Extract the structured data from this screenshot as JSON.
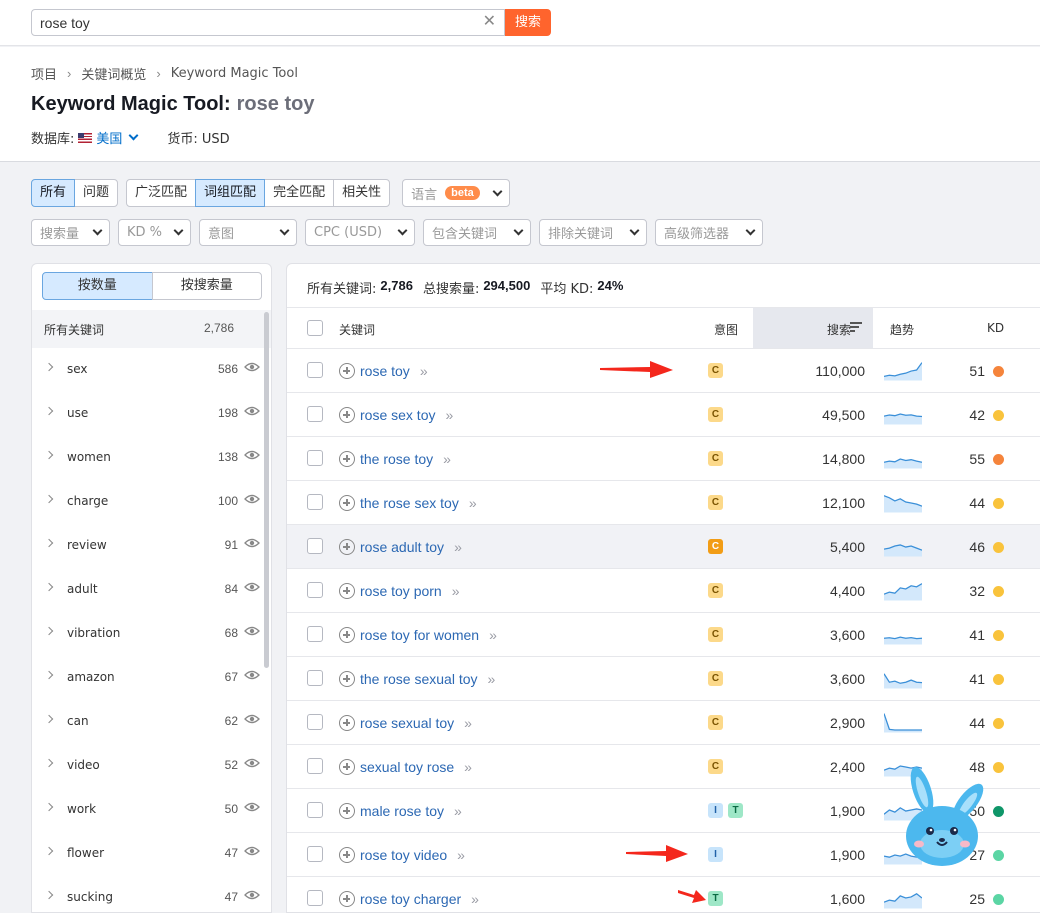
{
  "search": {
    "value": "rose toy",
    "button_label": "搜索"
  },
  "breadcrumb": [
    "项目",
    "关键词概览",
    "Keyword Magic Tool"
  ],
  "title": {
    "prefix": "Keyword Magic Tool:",
    "keyword": "rose toy"
  },
  "database": {
    "label": "数据库:",
    "country": "美国",
    "currency_label": "货币: USD"
  },
  "filters": {
    "match_group_a": [
      "所有",
      "问题"
    ],
    "match_group_b": [
      "广泛匹配",
      "词组匹配",
      "完全匹配",
      "相关性"
    ],
    "language": "语言",
    "beta": "beta",
    "dropdowns": [
      "搜索量",
      "KD %",
      "意图",
      "CPC (USD)",
      "包含关键词",
      "排除关键词",
      "高级筛选器"
    ]
  },
  "left_panel": {
    "toggle": [
      "按数量",
      "按搜索量"
    ],
    "all_label": "所有关键词",
    "all_count": "2,786",
    "groups": [
      {
        "name": "sex",
        "count": "586"
      },
      {
        "name": "use",
        "count": "198"
      },
      {
        "name": "women",
        "count": "138"
      },
      {
        "name": "charge",
        "count": "100"
      },
      {
        "name": "review",
        "count": "91"
      },
      {
        "name": "adult",
        "count": "84"
      },
      {
        "name": "vibration",
        "count": "68"
      },
      {
        "name": "amazon",
        "count": "67"
      },
      {
        "name": "can",
        "count": "62"
      },
      {
        "name": "video",
        "count": "52"
      },
      {
        "name": "work",
        "count": "50"
      },
      {
        "name": "flower",
        "count": "47"
      },
      {
        "name": "sucking",
        "count": "47"
      }
    ]
  },
  "summary": {
    "all_label": "所有关键词:",
    "all_value": "2,786",
    "volume_label": "总搜索量:",
    "volume_value": "294,500",
    "kd_label": "平均 KD:",
    "kd_value": "24%"
  },
  "table": {
    "headers": {
      "keyword": "关键词",
      "intent": "意图",
      "volume": "搜索",
      "trend": "趋势",
      "kd": "KD"
    },
    "rows": [
      {
        "keyword": "rose toy",
        "intent": [
          "C"
        ],
        "volume": "110,000",
        "kd": "51",
        "kd_color": "#f5843b",
        "trend": [
          0.2,
          0.25,
          0.22,
          0.3,
          0.35,
          0.45,
          0.5,
          0.85
        ]
      },
      {
        "keyword": "rose sex toy",
        "intent": [
          "C"
        ],
        "volume": "49,500",
        "kd": "42",
        "kd_color": "#f9c33c",
        "trend": [
          0.4,
          0.45,
          0.42,
          0.5,
          0.44,
          0.46,
          0.4,
          0.38
        ]
      },
      {
        "keyword": "the rose toy",
        "intent": [
          "C"
        ],
        "volume": "14,800",
        "kd": "55",
        "kd_color": "#f5843b",
        "trend": [
          0.3,
          0.35,
          0.32,
          0.45,
          0.38,
          0.42,
          0.35,
          0.3
        ]
      },
      {
        "keyword": "the rose sex toy",
        "intent": [
          "C"
        ],
        "volume": "12,100",
        "kd": "44",
        "kd_color": "#f9c33c",
        "trend": [
          0.8,
          0.7,
          0.55,
          0.65,
          0.5,
          0.45,
          0.4,
          0.3
        ]
      },
      {
        "keyword": "rose adult toy",
        "intent": [
          "Cstrong"
        ],
        "volume": "5,400",
        "kd": "46",
        "kd_color": "#f9c33c",
        "trend": [
          0.35,
          0.4,
          0.5,
          0.55,
          0.45,
          0.5,
          0.4,
          0.3
        ]
      },
      {
        "keyword": "rose toy porn",
        "intent": [
          "C"
        ],
        "volume": "4,400",
        "kd": "32",
        "kd_color": "#f9c33c",
        "trend": [
          0.3,
          0.4,
          0.35,
          0.6,
          0.55,
          0.7,
          0.65,
          0.8
        ]
      },
      {
        "keyword": "rose toy for women",
        "intent": [
          "C"
        ],
        "volume": "3,600",
        "kd": "41",
        "kd_color": "#f9c33c",
        "trend": [
          0.3,
          0.32,
          0.28,
          0.35,
          0.3,
          0.33,
          0.28,
          0.3
        ]
      },
      {
        "keyword": "the rose sexual toy",
        "intent": [
          "C"
        ],
        "volume": "3,600",
        "kd": "41",
        "kd_color": "#f9c33c",
        "trend": [
          0.7,
          0.3,
          0.35,
          0.25,
          0.3,
          0.4,
          0.3,
          0.28
        ]
      },
      {
        "keyword": "rose sexual toy",
        "intent": [
          "C"
        ],
        "volume": "2,900",
        "kd": "44",
        "kd_color": "#f9c33c",
        "trend": [
          0.9,
          0.15,
          0.12,
          0.12,
          0.12,
          0.12,
          0.12,
          0.12
        ]
      },
      {
        "keyword": "sexual toy rose",
        "intent": [
          "C"
        ],
        "volume": "2,400",
        "kd": "48",
        "kd_color": "#f9c33c",
        "trend": [
          0.3,
          0.4,
          0.35,
          0.5,
          0.45,
          0.4,
          0.45,
          0.4
        ]
      },
      {
        "keyword": "male rose toy",
        "intent": [
          "I",
          "T"
        ],
        "volume": "1,900",
        "kd": "50",
        "kd_color": "#0f9669",
        "trend": [
          0.3,
          0.5,
          0.4,
          0.6,
          0.45,
          0.5,
          0.55,
          0.5
        ]
      },
      {
        "keyword": "rose toy video",
        "intent": [
          "I"
        ],
        "volume": "1,900",
        "kd": "27",
        "kd_color": "#5bd5a4",
        "trend": [
          0.4,
          0.35,
          0.45,
          0.4,
          0.5,
          0.4,
          0.35,
          0.4
        ]
      },
      {
        "keyword": "rose toy charger",
        "intent": [
          "T"
        ],
        "volume": "1,600",
        "kd": "25",
        "kd_color": "#5bd5a4",
        "trend": [
          0.3,
          0.4,
          0.35,
          0.6,
          0.5,
          0.55,
          0.7,
          0.5
        ]
      }
    ]
  },
  "colors": {
    "accent": "#ff642d",
    "link": "#2c68b3",
    "active_bg": "#d6eaff"
  }
}
